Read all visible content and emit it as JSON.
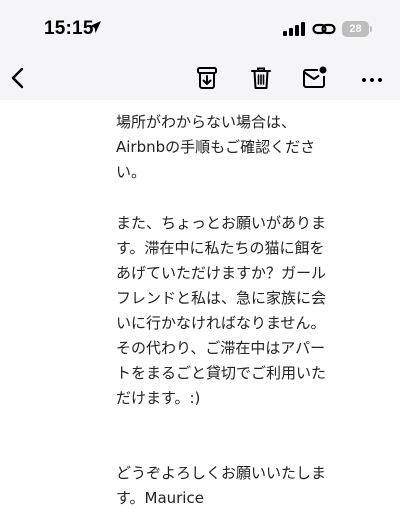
{
  "status_bar": {
    "time": "15:15",
    "battery": "28",
    "icons": [
      "location-arrow-icon",
      "cellular-signal-icon",
      "link-icon",
      "battery-icon"
    ]
  },
  "toolbar": {
    "icons": [
      "chevron-left-icon",
      "archive-icon",
      "trash-icon",
      "mark-unread-icon",
      "more-icon"
    ]
  },
  "message": {
    "lines": [
      "場所がわからない場合は、",
      "Airbnbの手順もご確認くださ",
      "い。",
      "また、ちょっとお願いがありま",
      "す。滞在中に私たちの猫に餌を",
      "あげていただけますか？ガール",
      "フレンドと私は、急に家族に会",
      "いに行かなければなりません。",
      "その代わり、ご滞在中はアパー",
      "トをまるごと貸切でご利用いた",
      "だけます。:)",
      "どうぞよろしくお願いいたしま",
      "す。Maurice"
    ]
  },
  "colors": {
    "header_bg": "#f5f5f7",
    "text": "#222222",
    "battery_bg": "#bdbdbd"
  }
}
